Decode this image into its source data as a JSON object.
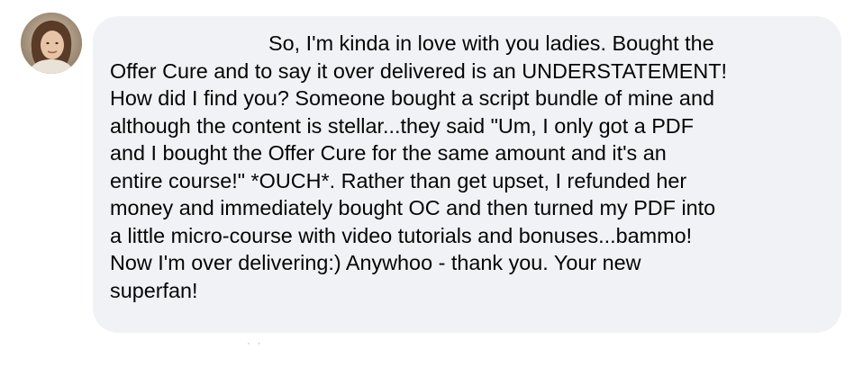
{
  "comment": {
    "lines": [
      "So, I'm kinda in love with you ladies. Bought the",
      "Offer Cure and to say it over delivered is an UNDERSTATEMENT!",
      "How did I find you? Someone bought a script bundle of mine and",
      "although the content is stellar...they said \"Um, I only got a PDF",
      "and I bought the Offer Cure for the same amount and it's an",
      "entire course!\" *OUCH*. Rather than get upset, I refunded her",
      "money and immediately bought OC and then turned my PDF into",
      "a little micro-course with video tutorials and bonuses...bammo!",
      "Now I'm over delivering:) Anywhoo - thank you. Your new",
      "superfan!"
    ]
  },
  "footer": {
    "dots": "· ·"
  },
  "colors": {
    "bubble_background": "#f0f2f5",
    "text": "#050505",
    "avatar_background": "#b8a48e"
  }
}
